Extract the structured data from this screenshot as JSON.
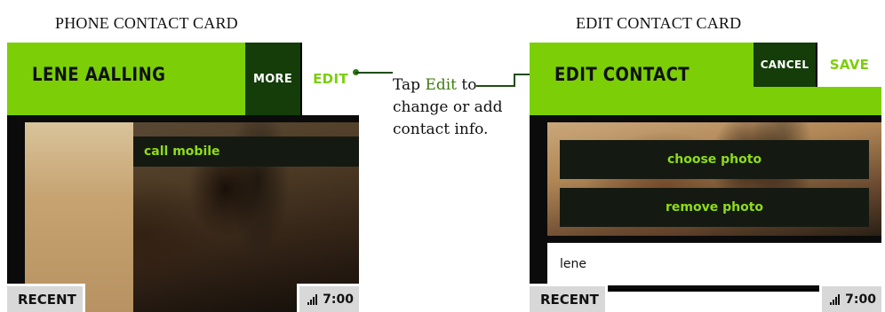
{
  "left_heading": "PHONE CONTACT CARD",
  "right_heading": "EDIT CONTACT CARD",
  "phone_card": {
    "title": "LENE AALLING",
    "more_label": "MORE",
    "edit_label": "EDIT",
    "call_label": "call mobile",
    "recent_label": "RECENT",
    "time": "7:00"
  },
  "edit_card": {
    "title": "EDIT CONTACT",
    "cancel_label": "CANCEL",
    "save_label": "SAVE",
    "choose_photo_label": "choose photo",
    "remove_photo_label": "remove photo",
    "name_value": "lene",
    "recent_label": "RECENT",
    "time": "7:00"
  },
  "callout": {
    "prefix": "Tap ",
    "highlight": "Edit",
    "suffix": " to change or add contact info."
  },
  "colors": {
    "accent_green": "#7ccf06",
    "dark_green": "#143d0a",
    "callout_highlight": "#3d7a10"
  },
  "icons": {
    "signal": "signal-strength-icon"
  }
}
